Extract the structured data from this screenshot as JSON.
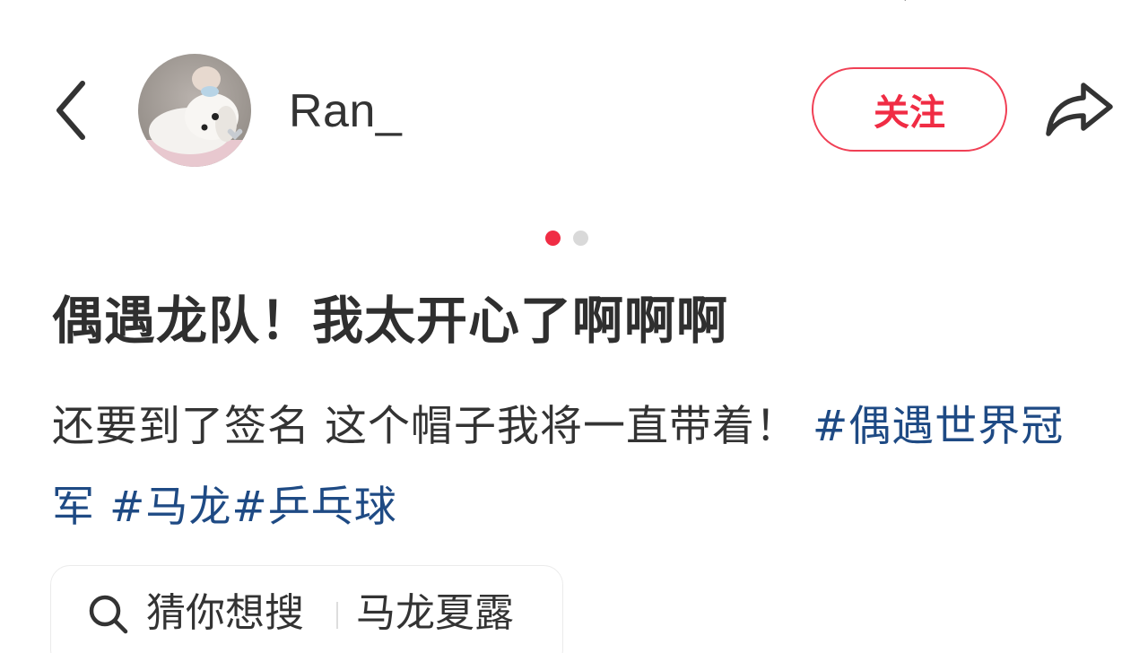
{
  "header": {
    "back_icon": "chevron-left-icon",
    "author": {
      "name": "Ran_",
      "avatar_icon": "dog-avatar"
    },
    "follow_label": "关注",
    "share_icon": "share-arrow-icon"
  },
  "carousel": {
    "page_count": 2,
    "active_index": 0,
    "active_color": "#f02c44",
    "inactive_color": "#d9d9d9"
  },
  "post": {
    "title": "偶遇龙队！我太开心了啊啊啊",
    "body_text": "还要到了签名 这个帽子我将一直带着！",
    "hashtags": [
      "#偶遇世界冠军",
      "#马龙",
      "#乒乓球"
    ],
    "hashtag_color": "#1e4a84"
  },
  "search_suggestion": {
    "icon": "search-icon",
    "label": "猜你想搜",
    "term": "马龙夏露"
  },
  "colors": {
    "accent": "#f02c44",
    "text": "#333333",
    "hashtag": "#1e4a84"
  }
}
